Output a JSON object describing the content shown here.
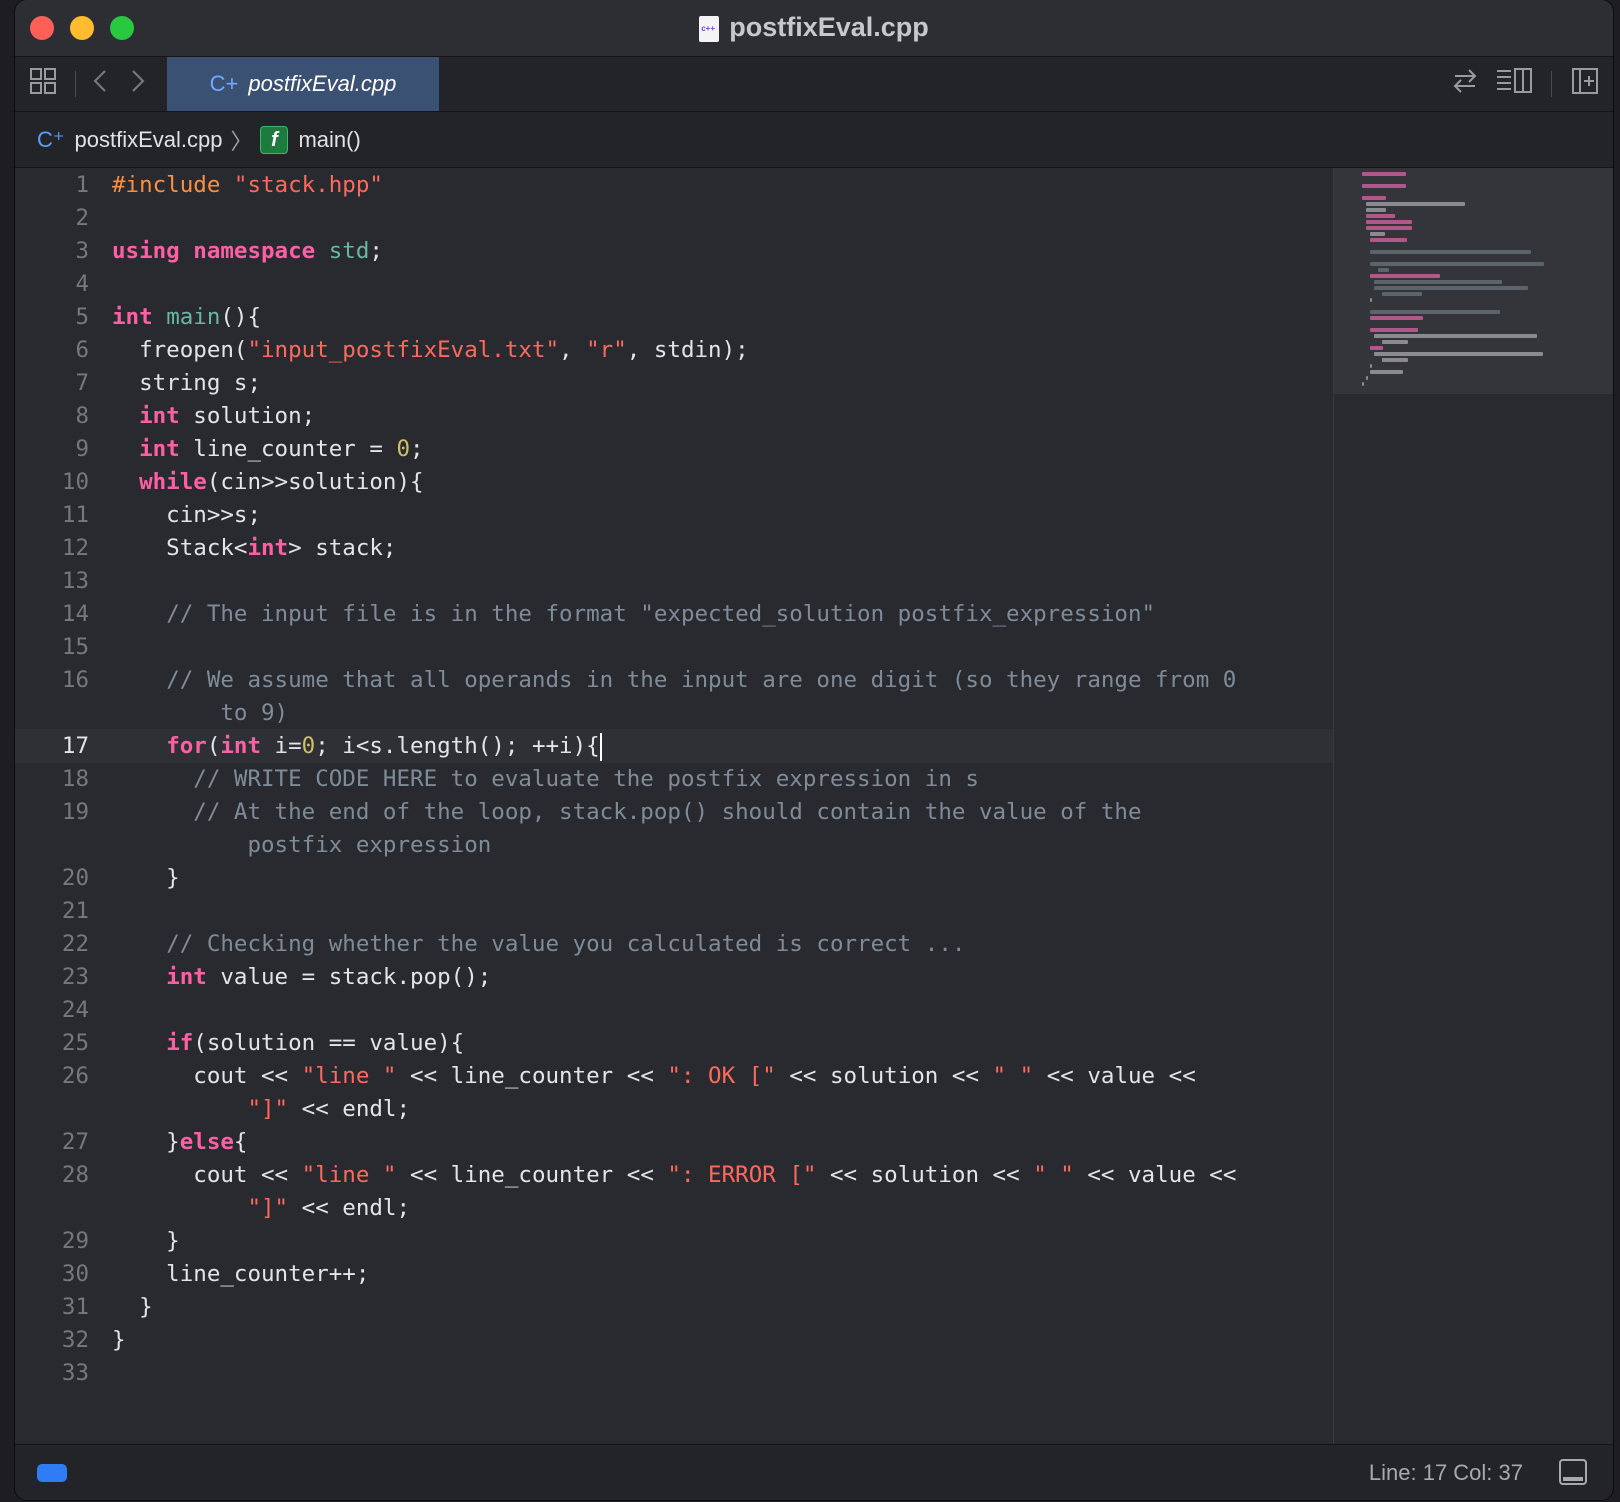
{
  "window": {
    "title": "postfixEval.cpp",
    "file_icon_text": "c++"
  },
  "tabbar": {
    "active_tab_label": "postfixEval.cpp",
    "active_tab_icon": "C+"
  },
  "breadcrumb": {
    "file": "postfixEval.cpp",
    "symbol": "main()"
  },
  "editor": {
    "current_line": 17,
    "lines": [
      {
        "n": "1",
        "html": "<span class='pp'>#include</span> <span class='str'>\"stack.hpp\"</span>"
      },
      {
        "n": "2",
        "html": ""
      },
      {
        "n": "3",
        "html": "<span class='kw'>using</span> <span class='kw'>namespace</span> <span class='fn'>std</span>;"
      },
      {
        "n": "4",
        "html": ""
      },
      {
        "n": "5",
        "html": "<span class='kw'>int</span> <span class='fn'>main</span>(){"
      },
      {
        "n": "6",
        "html": "  freopen(<span class='str'>\"input_postfixEval.txt\"</span>, <span class='str'>\"r\"</span>, stdin);"
      },
      {
        "n": "7",
        "html": "  string s;"
      },
      {
        "n": "8",
        "html": "  <span class='kw'>int</span> solution;"
      },
      {
        "n": "9",
        "html": "  <span class='kw'>int</span> line_counter = <span class='num'>0</span>;"
      },
      {
        "n": "10",
        "html": "  <span class='kw'>while</span>(cin&gt;&gt;solution){"
      },
      {
        "n": "11",
        "html": "    cin&gt;&gt;s;"
      },
      {
        "n": "12",
        "html": "    Stack&lt;<span class='kw'>int</span>&gt; stack;"
      },
      {
        "n": "13",
        "html": ""
      },
      {
        "n": "14",
        "html": "    <span class='cm'>// The input file is in the format \"expected_solution postfix_expression\"</span>"
      },
      {
        "n": "15",
        "html": ""
      },
      {
        "n": "16",
        "html": "    <span class='cm'>// We assume that all operands in the input are one digit (so they range from 0</span>"
      },
      {
        "n": "",
        "html": "<span class='cm'>        to 9)</span>"
      },
      {
        "n": "17",
        "html": "    <span class='kw'>for</span>(<span class='kw'>int</span> i=<span class='num'>0</span>; i&lt;s.length(); ++i){<span class='cursor'></span>",
        "current": true
      },
      {
        "n": "18",
        "html": "      <span class='cm'>// WRITE CODE HERE to evaluate the postfix expression in s</span>"
      },
      {
        "n": "19",
        "html": "      <span class='cm'>// At the end of the loop, stack.pop() should contain the value of the</span>"
      },
      {
        "n": "",
        "html": "<span class='cm'>          postfix expression</span>"
      },
      {
        "n": "20",
        "html": "    }"
      },
      {
        "n": "21",
        "html": ""
      },
      {
        "n": "22",
        "html": "    <span class='cm'>// Checking whether the value you calculated is correct ...</span>"
      },
      {
        "n": "23",
        "html": "    <span class='kw'>int</span> value = stack.pop();"
      },
      {
        "n": "24",
        "html": ""
      },
      {
        "n": "25",
        "html": "    <span class='kw'>if</span>(solution == value){"
      },
      {
        "n": "26",
        "html": "      cout &lt;&lt; <span class='str'>\"line \"</span> &lt;&lt; line_counter &lt;&lt; <span class='str'>\": OK [\"</span> &lt;&lt; solution &lt;&lt; <span class='str'>\" \"</span> &lt;&lt; value &lt;&lt;"
      },
      {
        "n": "",
        "html": "          <span class='str'>\"]\"</span> &lt;&lt; endl;"
      },
      {
        "n": "27",
        "html": "    }<span class='kw'>else</span>{"
      },
      {
        "n": "28",
        "html": "      cout &lt;&lt; <span class='str'>\"line \"</span> &lt;&lt; line_counter &lt;&lt; <span class='str'>\": ERROR [\"</span> &lt;&lt; solution &lt;&lt; <span class='str'>\" \"</span> &lt;&lt; value &lt;&lt;"
      },
      {
        "n": "",
        "html": "          <span class='str'>\"]\"</span> &lt;&lt; endl;"
      },
      {
        "n": "29",
        "html": "    }"
      },
      {
        "n": "30",
        "html": "    line_counter++;"
      },
      {
        "n": "31",
        "html": "  }"
      },
      {
        "n": "32",
        "html": "}"
      },
      {
        "n": "33",
        "html": ""
      }
    ]
  },
  "statusbar": {
    "position": "Line: 17  Col: 37"
  },
  "colors": {
    "keyword": "#fc5fa3",
    "preprocessor": "#fd8f3f",
    "string": "#fc6a5d",
    "number": "#d0bf69",
    "comment": "#7f8c98",
    "tab_active": "#3b5173"
  },
  "icons": [
    "grid-icon",
    "back-icon",
    "forward-icon",
    "swap-icon",
    "inspector-icon",
    "add-editor-icon",
    "function-icon",
    "cpp-file-icon",
    "bottom-panel-icon"
  ]
}
